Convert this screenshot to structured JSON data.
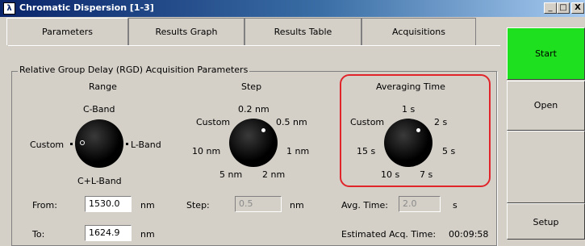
{
  "window": {
    "title": "Chromatic Dispersion [1-3]",
    "app_icon": "λ",
    "buttons": {
      "minimize": "_",
      "maximize": "□",
      "close": "X"
    }
  },
  "tabs": [
    "Parameters",
    "Results Graph",
    "Results Table",
    "Acquisitions"
  ],
  "group_title": "Relative Group Delay (RGD) Acquisition Parameters",
  "range": {
    "heading": "Range",
    "options": {
      "top": "C-Band",
      "left": "Custom",
      "right": "L-Band",
      "bottom": "C+L-Band"
    },
    "selected": "Custom"
  },
  "step": {
    "heading": "Step",
    "options": [
      "0.2 nm",
      "0.5 nm",
      "1 nm",
      "2 nm",
      "5 nm",
      "10 nm",
      "Custom"
    ],
    "selected": "0.5 nm"
  },
  "averaging_time": {
    "heading": "Averaging Time",
    "options": [
      "1 s",
      "2 s",
      "5 s",
      "7 s",
      "10 s",
      "15 s",
      "Custom"
    ],
    "selected": "2 s"
  },
  "fields": {
    "from": {
      "label": "From:",
      "value": "1530.0",
      "unit": "nm"
    },
    "to": {
      "label": "To:",
      "value": "1624.9",
      "unit": "nm"
    },
    "step": {
      "label": "Step:",
      "value": "0.5",
      "unit": "nm"
    },
    "avg_time": {
      "label": "Avg. Time:",
      "value": "2.0",
      "unit": "s"
    }
  },
  "estimated": {
    "label": "Estimated Acq. Time:",
    "value": "00:09:58"
  },
  "side_buttons": {
    "start": "Start",
    "open": "Open",
    "setup": "Setup"
  },
  "colors": {
    "start": "#1fe01f",
    "highlight": "#e0242a",
    "titlebar": "#0a246a"
  }
}
